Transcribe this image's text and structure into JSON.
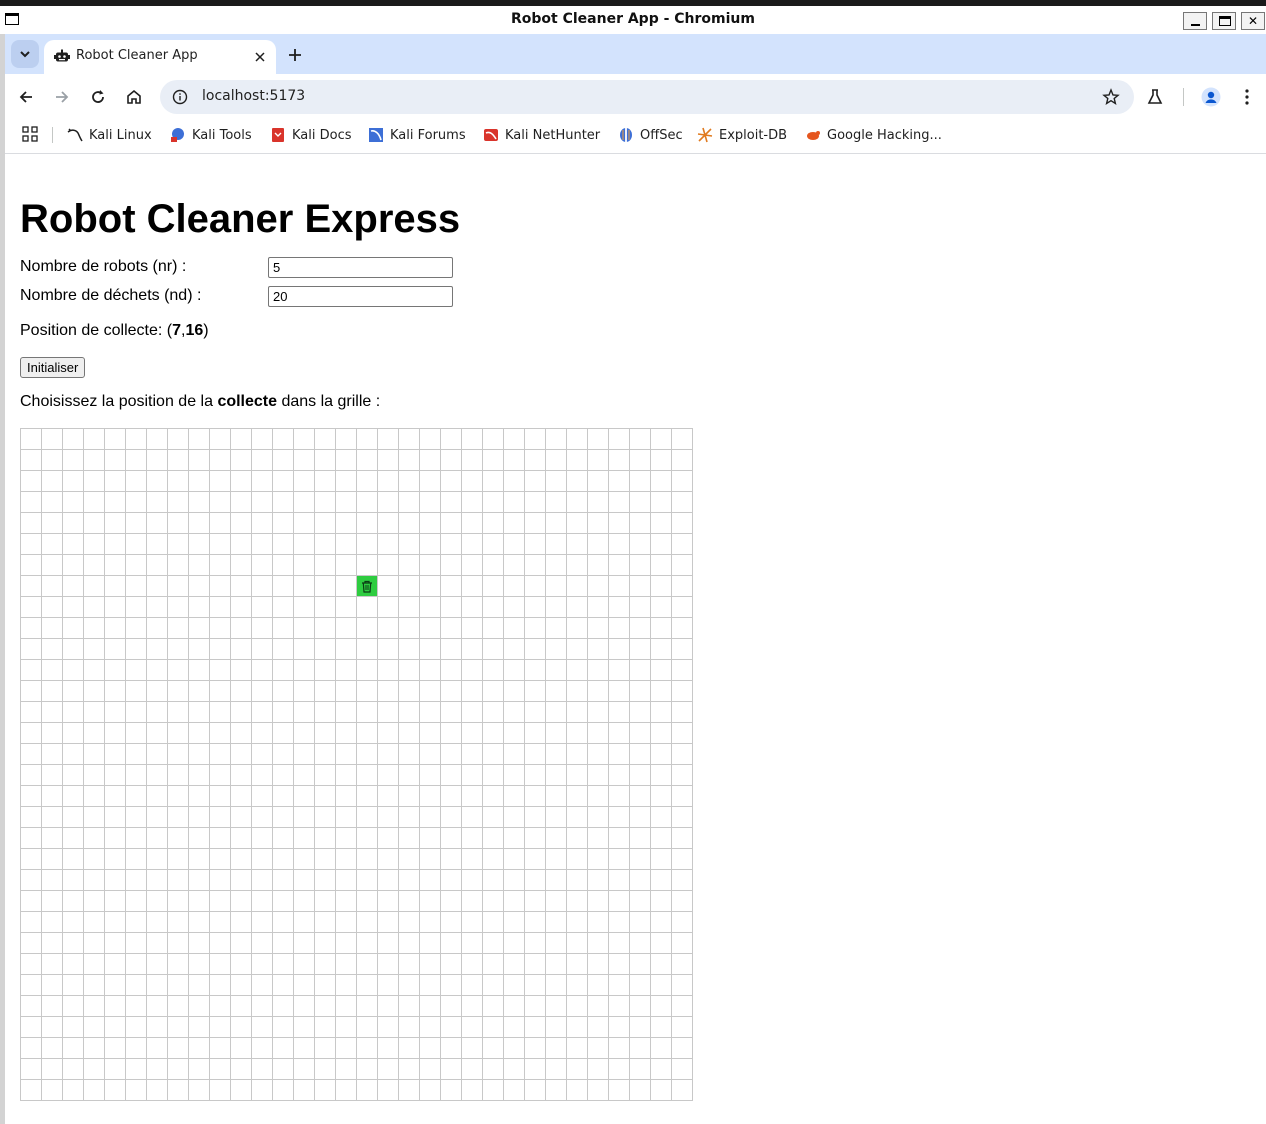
{
  "window": {
    "title": "Robot Cleaner App - Chromium"
  },
  "tabs": [
    {
      "label": "Robot Cleaner App",
      "icon": "robot-icon",
      "active": true
    }
  ],
  "address_bar": {
    "url": "localhost:5173"
  },
  "bookmarks": [
    {
      "label": "Kali Linux",
      "icon": "kali-dragon-icon"
    },
    {
      "label": "Kali Tools",
      "icon": "kali-tools-icon"
    },
    {
      "label": "Kali Docs",
      "icon": "kali-docs-icon"
    },
    {
      "label": "Kali Forums",
      "icon": "kali-forums-icon"
    },
    {
      "label": "Kali NetHunter",
      "icon": "kali-nethunter-icon"
    },
    {
      "label": "OffSec",
      "icon": "offsec-icon"
    },
    {
      "label": "Exploit-DB",
      "icon": "exploit-db-icon"
    },
    {
      "label": "Google Hacking...",
      "icon": "google-hacking-icon"
    }
  ],
  "page": {
    "heading": "Robot Cleaner Express",
    "robots_label": "Nombre de robots (nr) :",
    "robots_value": "5",
    "waste_label": "Nombre de déchets (nd) :",
    "waste_value": "20",
    "position_prefix": "Position de collecte: (",
    "position_x": "7",
    "position_sep": ",",
    "position_y": "16",
    "position_suffix": ")",
    "init_button": "Initialiser",
    "choose_prefix": "Choisissez la position de la ",
    "choose_bold": "collecte",
    "choose_suffix": " dans la grille :"
  },
  "grid": {
    "size": 32,
    "collect_row": 7,
    "collect_col": 16,
    "collect_color": "#2ecc40",
    "collect_icon": "trash-icon"
  }
}
